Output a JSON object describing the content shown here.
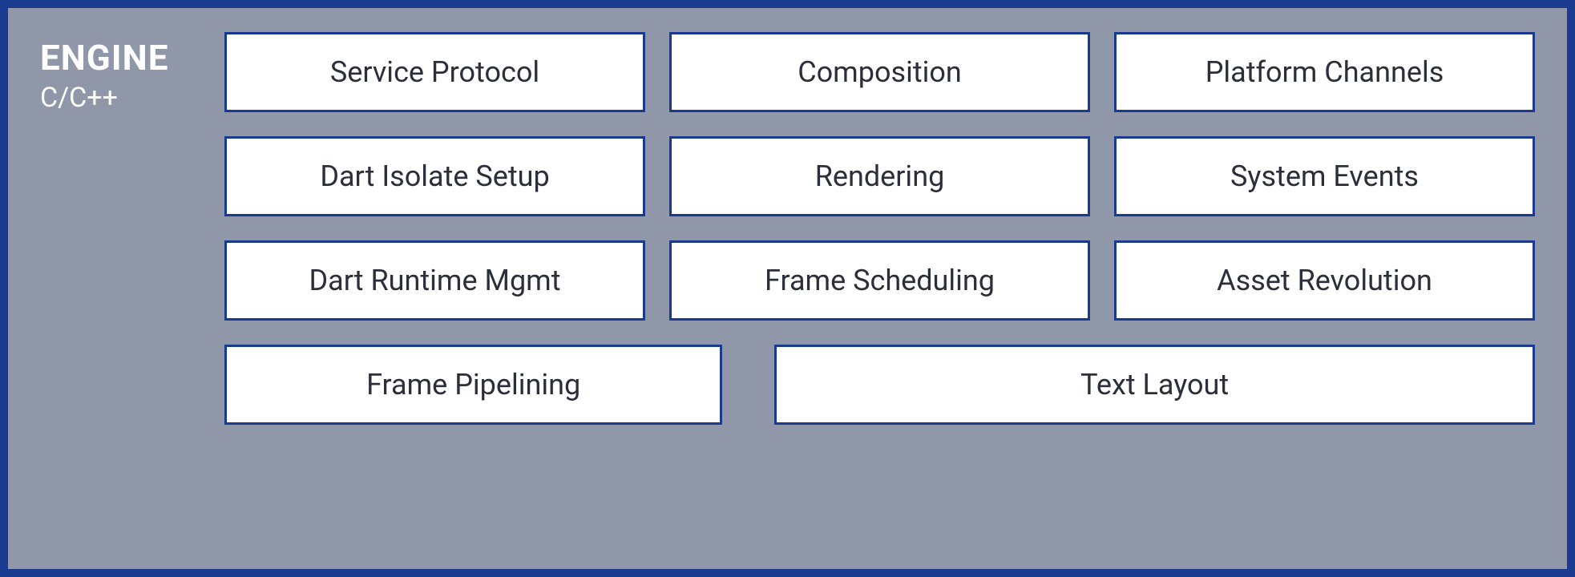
{
  "section": {
    "title": "ENGINE",
    "subtitle": "C/C++"
  },
  "rows": [
    [
      "Service Protocol",
      "Composition",
      "Platform Channels"
    ],
    [
      "Dart Isolate Setup",
      "Rendering",
      "System Events"
    ],
    [
      "Dart Runtime Mgmt",
      "Frame Scheduling",
      "Asset Revolution"
    ],
    [
      "Frame Pipelining",
      "Text Layout"
    ]
  ]
}
